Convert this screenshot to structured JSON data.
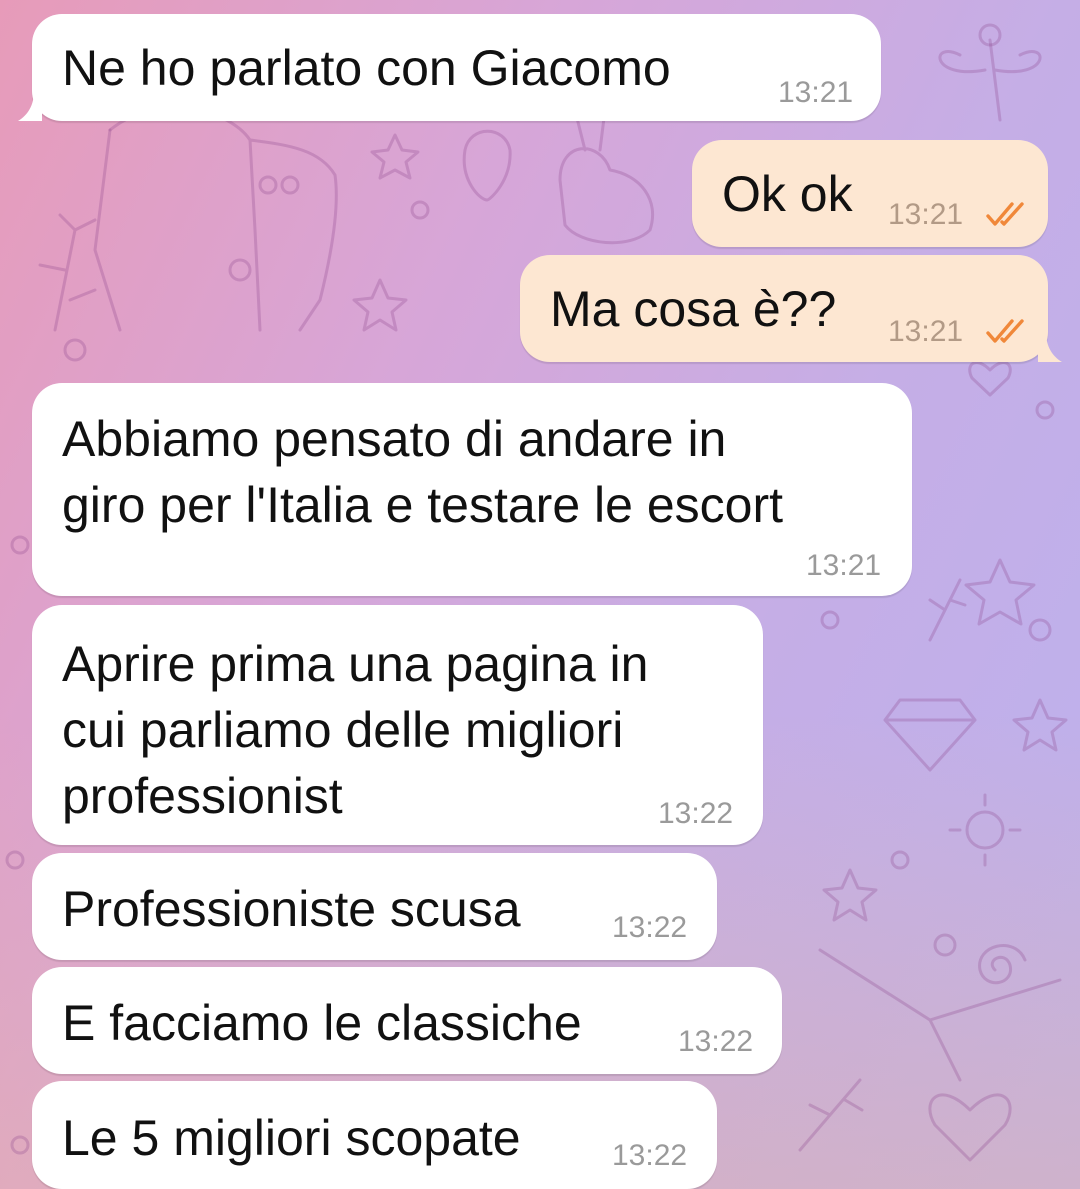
{
  "colors": {
    "incoming_bubble": "#ffffff",
    "outgoing_bubble": "#fde7d2",
    "message_text": "#111111",
    "timestamp": "#9a9a9a",
    "read_ticks": "#f0883a"
  },
  "messages": [
    {
      "direction": "incoming",
      "text": "Ne ho parlato con Giacomo",
      "time": "13:21"
    },
    {
      "direction": "outgoing",
      "text": "Ok ok",
      "time": "13:21",
      "status_icon": "double-check-icon"
    },
    {
      "direction": "outgoing",
      "text": "Ma cosa è??",
      "time": "13:21",
      "status_icon": "double-check-icon"
    },
    {
      "direction": "incoming",
      "lines": [
        "Abbiamo pensato di andare in",
        "giro per l'Italia e testare le escort"
      ],
      "time": "13:21"
    },
    {
      "direction": "incoming",
      "lines": [
        "Aprire prima una pagina in",
        "cui parliamo delle migliori",
        "professionist"
      ],
      "time": "13:22"
    },
    {
      "direction": "incoming",
      "text": "Professioniste scusa",
      "time": "13:22"
    },
    {
      "direction": "incoming",
      "text": "E facciamo le classiche",
      "time": "13:22"
    },
    {
      "direction": "incoming",
      "text": "Le 5 migliori scopate",
      "time": "13:22"
    }
  ]
}
